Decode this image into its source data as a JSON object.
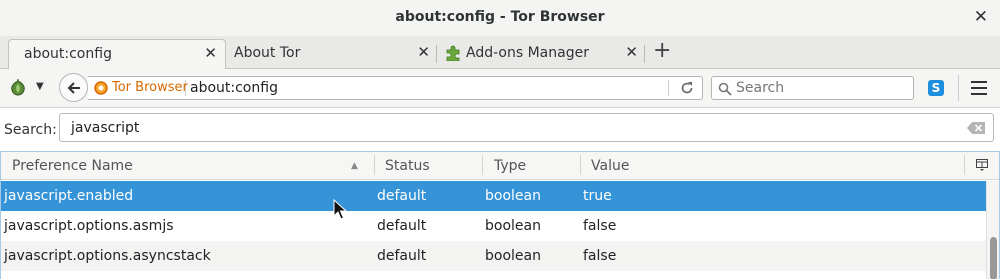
{
  "window": {
    "title": "about:config - Tor Browser",
    "close_glyph": "✕"
  },
  "tabs": [
    {
      "label": "about:config",
      "active": true
    },
    {
      "label": "About Tor",
      "active": false
    },
    {
      "label": "Add-ons Manager",
      "active": false,
      "icon": "puzzle-icon"
    }
  ],
  "tab_close_glyph": "✕",
  "new_tab_glyph": "+",
  "navbar": {
    "identity_label": "Tor Browser",
    "url": "about:config",
    "search_placeholder": "Search",
    "skype_glyph": "S"
  },
  "config": {
    "search_label": "Search:",
    "search_value": "javascript",
    "columns": [
      "Preference Name",
      "Status",
      "Type",
      "Value"
    ],
    "rows": [
      {
        "name": "javascript.enabled",
        "status": "default",
        "type": "boolean",
        "value": "true",
        "selected": true
      },
      {
        "name": "javascript.options.asmjs",
        "status": "default",
        "type": "boolean",
        "value": "false",
        "selected": false
      },
      {
        "name": "javascript.options.asyncstack",
        "status": "default",
        "type": "boolean",
        "value": "false",
        "selected": false
      }
    ]
  },
  "colors": {
    "selection": "#3593d8",
    "tor_orange": "#d56a00",
    "skype_blue": "#1d8fde"
  }
}
